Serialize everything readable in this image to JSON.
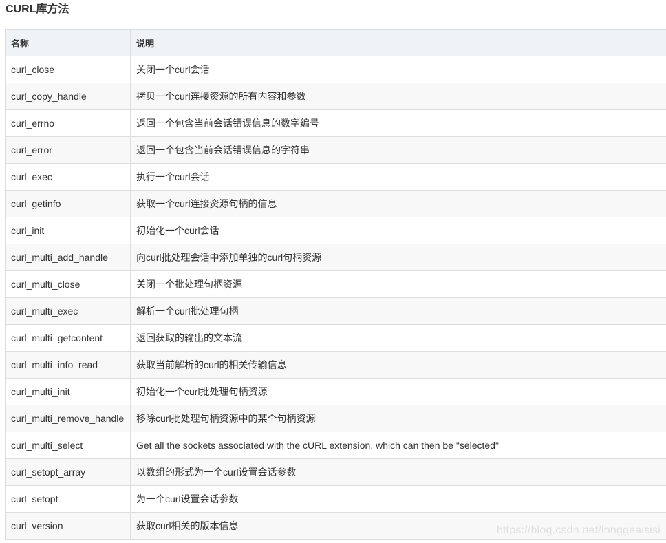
{
  "page_title": "CURL库方法",
  "table": {
    "headers": {
      "name": "名称",
      "desc": "说明"
    },
    "rows": [
      {
        "name": "curl_close",
        "desc": "关闭一个curl会话"
      },
      {
        "name": "curl_copy_handle",
        "desc": "拷贝一个curl连接资源的所有内容和参数"
      },
      {
        "name": "curl_errno",
        "desc": "返回一个包含当前会话错误信息的数字编号"
      },
      {
        "name": "curl_error",
        "desc": "返回一个包含当前会话错误信息的字符串"
      },
      {
        "name": "curl_exec",
        "desc": "执行一个curl会话"
      },
      {
        "name": "curl_getinfo",
        "desc": "获取一个curl连接资源句柄的信息"
      },
      {
        "name": "curl_init",
        "desc": "初始化一个curl会话"
      },
      {
        "name": "curl_multi_add_handle",
        "desc": "向curl批处理会话中添加单独的curl句柄资源"
      },
      {
        "name": "curl_multi_close",
        "desc": "关闭一个批处理句柄资源"
      },
      {
        "name": "curl_multi_exec",
        "desc": "解析一个curl批处理句柄"
      },
      {
        "name": "curl_multi_getcontent",
        "desc": "返回获取的输出的文本流"
      },
      {
        "name": "curl_multi_info_read",
        "desc": "获取当前解析的curl的相关传输信息"
      },
      {
        "name": "curl_multi_init",
        "desc": "初始化一个curl批处理句柄资源"
      },
      {
        "name": "curl_multi_remove_handle",
        "desc": "移除curl批处理句柄资源中的某个句柄资源"
      },
      {
        "name": "curl_multi_select",
        "desc": "Get all the sockets associated with the cURL extension, which can then be \"selected\""
      },
      {
        "name": "curl_setopt_array",
        "desc": "以数组的形式为一个curl设置会话参数"
      },
      {
        "name": "curl_setopt",
        "desc": "为一个curl设置会话参数"
      },
      {
        "name": "curl_version",
        "desc": "获取curl相关的版本信息"
      }
    ]
  },
  "watermark": "https://blog.csdn.net/longgeaisisi"
}
